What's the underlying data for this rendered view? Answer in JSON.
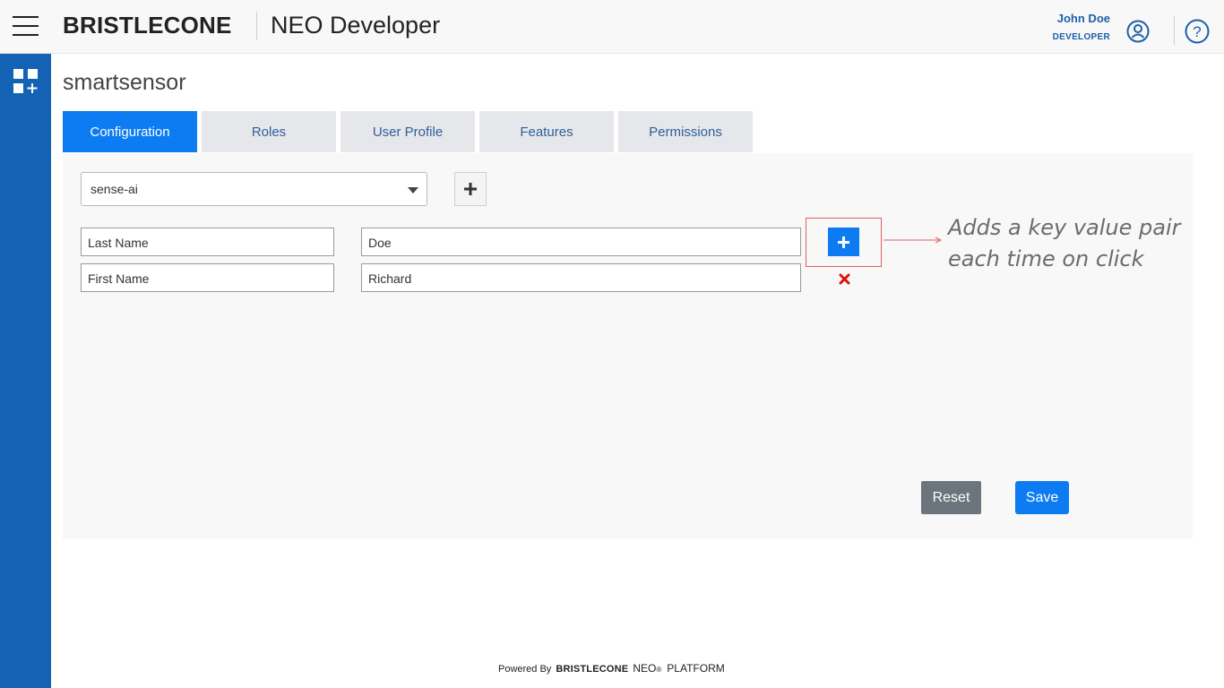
{
  "header": {
    "brand": "BRISTLECONE",
    "app_title": "NEO Developer",
    "user_name": "John Doe",
    "user_role": "DEVELOPER",
    "menu_icon": "hamburger-menu-icon",
    "user_icon": "user-circle-icon",
    "help_icon": "help-circle-icon"
  },
  "sidebar": {
    "apps_icon": "apps-add-icon"
  },
  "page": {
    "title": "smartsensor"
  },
  "tabs": [
    {
      "label": "Configuration",
      "active": true
    },
    {
      "label": "Roles",
      "active": false
    },
    {
      "label": "User Profile",
      "active": false
    },
    {
      "label": "Features",
      "active": false
    },
    {
      "label": "Permissions",
      "active": false
    }
  ],
  "config": {
    "environment_selected": "sense-ai",
    "pairs": [
      {
        "key": "Last Name",
        "value": "Doe"
      },
      {
        "key": "First Name",
        "value": "Richard"
      }
    ],
    "annotation": "Adds a key value pair each time on click",
    "reset_label": "Reset",
    "save_label": "Save"
  },
  "footer": {
    "powered_by": "Powered By",
    "brand": "BRISTLECONE",
    "neo": "NEO",
    "registered": "®",
    "platform": "PLATFORM"
  },
  "colors": {
    "primary": "#0d7cf2",
    "sidebar": "#1362b4",
    "reset": "#6c757d",
    "remove": "#e01010",
    "link_text": "#2d5f9b"
  }
}
